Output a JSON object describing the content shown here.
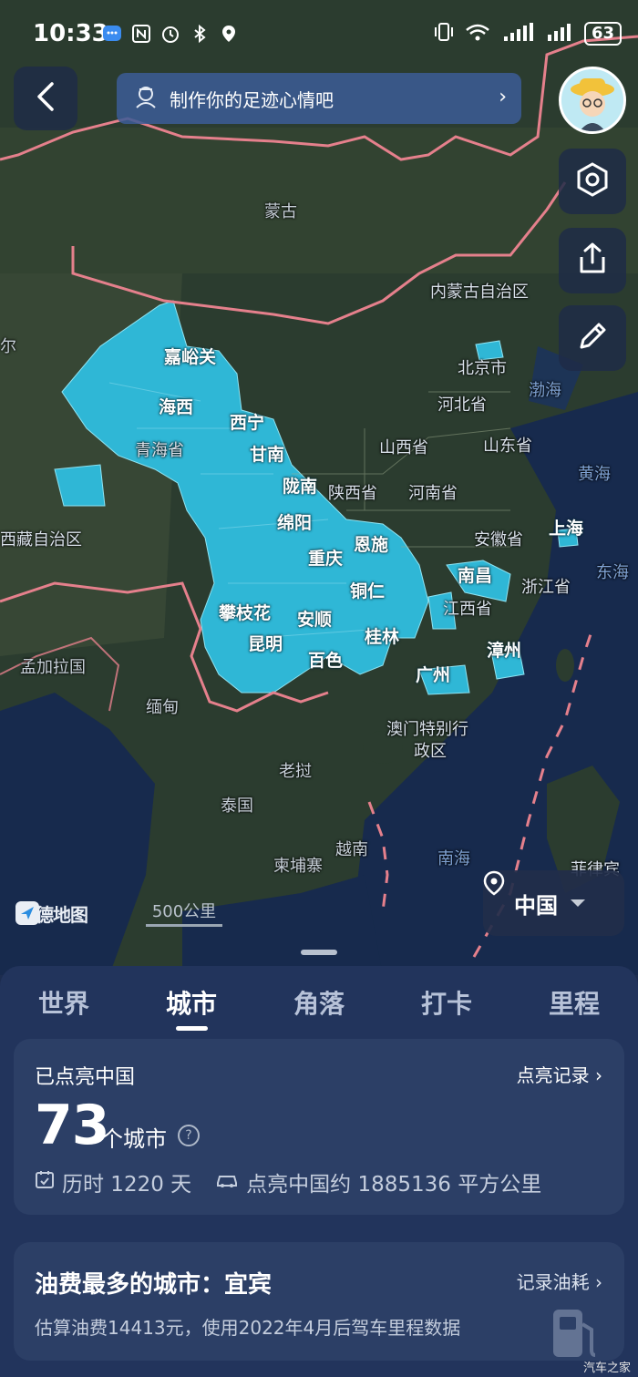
{
  "status_bar": {
    "time": "10:33",
    "battery": "63"
  },
  "header": {
    "banner_text": "制作你的足迹心情吧"
  },
  "map": {
    "countries": [
      "蒙古",
      "缅甸",
      "老挝",
      "泰国",
      "越南",
      "柬埔寨",
      "孟加拉国",
      "尔"
    ],
    "regions": [
      "内蒙古自治区",
      "北京市",
      "河北省",
      "山西省",
      "山东省",
      "陕西省",
      "河南省",
      "安徽省",
      "浙江省",
      "江西省",
      "西藏自治区",
      "青海省",
      "澳门特别行",
      "政区",
      "菲律宾"
    ],
    "seas": [
      "渤海",
      "黄海",
      "东海",
      "南海"
    ],
    "lit_cities": [
      "嘉峪关",
      "海西",
      "西宁",
      "甘南",
      "陇南",
      "绵阳",
      "重庆",
      "恩施",
      "铜仁",
      "攀枝花",
      "安顺",
      "昆明",
      "百色",
      "桂林",
      "广州",
      "南昌",
      "漳州",
      "上海"
    ],
    "provider": "高德地图",
    "scale": "500公里",
    "region_selector": "中国",
    "highlight_color": "#2fb7d6"
  },
  "tabs": [
    {
      "label": "世界",
      "active": false
    },
    {
      "label": "城市",
      "active": true
    },
    {
      "label": "角落",
      "active": false
    },
    {
      "label": "打卡",
      "active": false
    },
    {
      "label": "里程",
      "active": false
    }
  ],
  "summary_card": {
    "title": "已点亮中国",
    "link": "点亮记录",
    "city_count": "73",
    "unit": "个城市",
    "duration": "历时 1220 天",
    "area": "点亮中国约 1885136 平方公里"
  },
  "fuel_card": {
    "title": "油费最多的城市：宜宾",
    "link": "记录油耗",
    "subtitle": "估算油费14413元，使用2022年4月后驾车里程数据"
  },
  "watermark": "汽车之家"
}
